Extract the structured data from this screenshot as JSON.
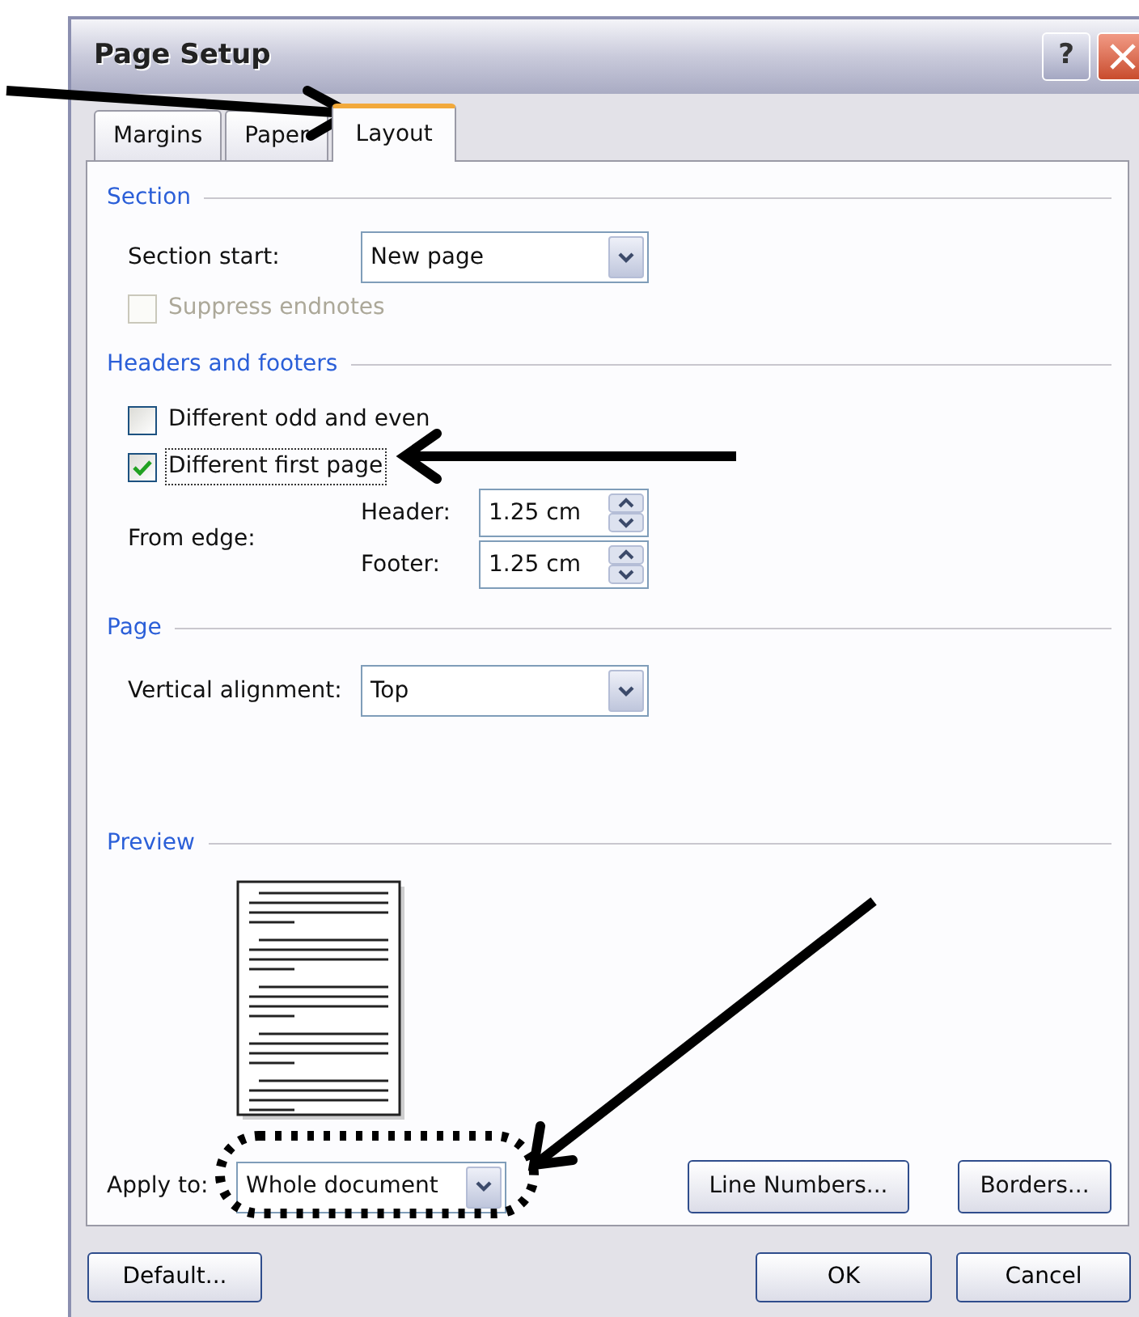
{
  "window": {
    "title": "Page Setup",
    "help_button": "?"
  },
  "tabs": [
    {
      "label": "Margins",
      "selected": false
    },
    {
      "label": "Paper",
      "selected": false
    },
    {
      "label": "Layout",
      "selected": true
    }
  ],
  "section": {
    "heading": "Section",
    "section_start": {
      "label": "Section start:",
      "value": "New page"
    },
    "suppress_endnotes": {
      "label": "Suppress endnotes",
      "checked": false,
      "disabled": true
    }
  },
  "headers_and_footers": {
    "heading": "Headers and footers",
    "options": [
      {
        "label": "Different odd and even",
        "checked": false,
        "focused": false
      },
      {
        "label": "Different first page",
        "checked": true,
        "focused": true
      }
    ],
    "from_edge": {
      "label": "From edge:",
      "fields": [
        {
          "label": "Header:",
          "value": "1.25 cm"
        },
        {
          "label": "Footer:",
          "value": "1.25 cm"
        }
      ]
    }
  },
  "page": {
    "heading": "Page",
    "vertical_alignment": {
      "label": "Vertical alignment:",
      "value": "Top"
    }
  },
  "preview": {
    "heading": "Preview",
    "apply_to": {
      "label": "Apply to:",
      "value": "Whole document"
    },
    "buttons": [
      "Line Numbers...",
      "Borders..."
    ]
  },
  "footer_buttons": [
    {
      "label": "Default...",
      "kind": "default"
    },
    {
      "label": "OK",
      "kind": "ok"
    },
    {
      "label": "Cancel",
      "kind": "cancel"
    }
  ]
}
